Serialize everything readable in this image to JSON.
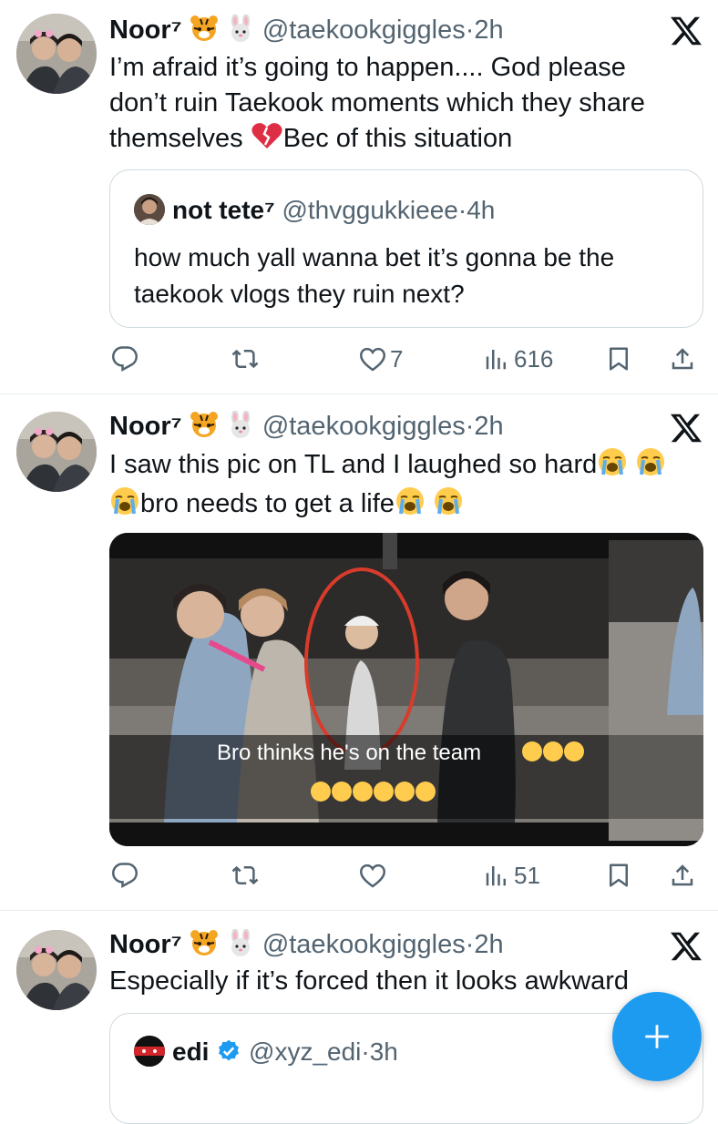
{
  "tweets": [
    {
      "display_name": "Noor⁷",
      "handle": "@taekookgiggles",
      "time": "2h",
      "text_lines": [
        "I’m afraid it’s going to happen.... God please",
        "don’t ruin Taekook moments which they share",
        "themselves",
        "Bec of this situation"
      ],
      "quote": {
        "display_name": "not tete⁷",
        "handle": "@thvggukkieee",
        "time": "4h",
        "text_lines": [
          "how much yall wanna bet it’s gonna be the",
          "taekook vlogs they ruin next?"
        ]
      },
      "likes": "7",
      "views": "616"
    },
    {
      "display_name": "Noor⁷",
      "handle": "@taekookgiggles",
      "time": "2h",
      "text_lines": [
        "I saw this pic on TL and I laughed so hard",
        "bro needs to get a life"
      ],
      "media_caption": "Bro thinks he's on the team",
      "likes": "",
      "views": "51"
    },
    {
      "display_name": "Noor⁷",
      "handle": "@taekookgiggles",
      "time": "2h",
      "text_lines": [
        "Especially if it’s forced then it looks awkward"
      ],
      "quote": {
        "display_name": "edi",
        "handle": "@xyz_edi",
        "time": "3h"
      }
    }
  ],
  "icons": {
    "reply": "reply-icon",
    "retweet": "retweet-icon",
    "like": "heart-icon",
    "views": "views-icon",
    "bookmark": "bookmark-icon",
    "share": "share-icon",
    "compose": "plus-icon",
    "logo": "x-logo-icon"
  },
  "colors": {
    "accent": "#1d9bf0",
    "muted": "#536471",
    "border": "#cfd9de"
  }
}
